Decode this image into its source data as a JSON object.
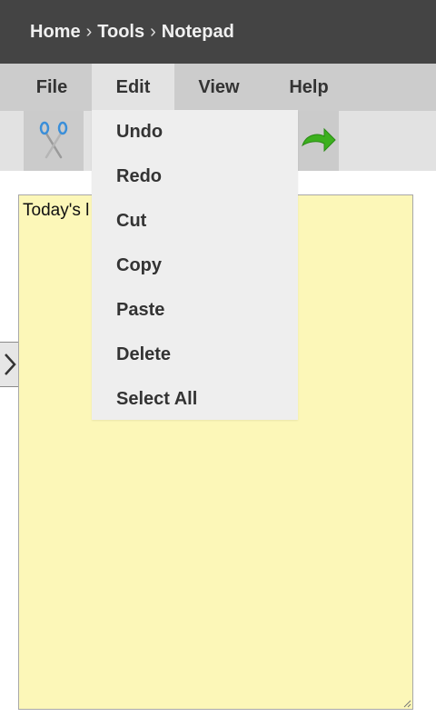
{
  "breadcrumb": {
    "items": [
      "Home",
      "Tools",
      "Notepad"
    ],
    "separator": "›"
  },
  "menubar": {
    "items": [
      "File",
      "Edit",
      "View",
      "Help"
    ],
    "active": "Edit"
  },
  "toolbar": {
    "buttons": [
      "scissors-icon",
      "redo-arrow-icon"
    ]
  },
  "editor": {
    "content": "Today's l"
  },
  "edit_menu": {
    "items": [
      "Undo",
      "Redo",
      "Cut",
      "Copy",
      "Paste",
      "Delete",
      "Select All"
    ]
  },
  "colors": {
    "header_bg": "#444444",
    "menubar_bg": "#cccccc",
    "dropdown_bg": "#eeeeee",
    "editor_bg": "#fcf7b8",
    "arrow_green": "#3cb01e"
  }
}
